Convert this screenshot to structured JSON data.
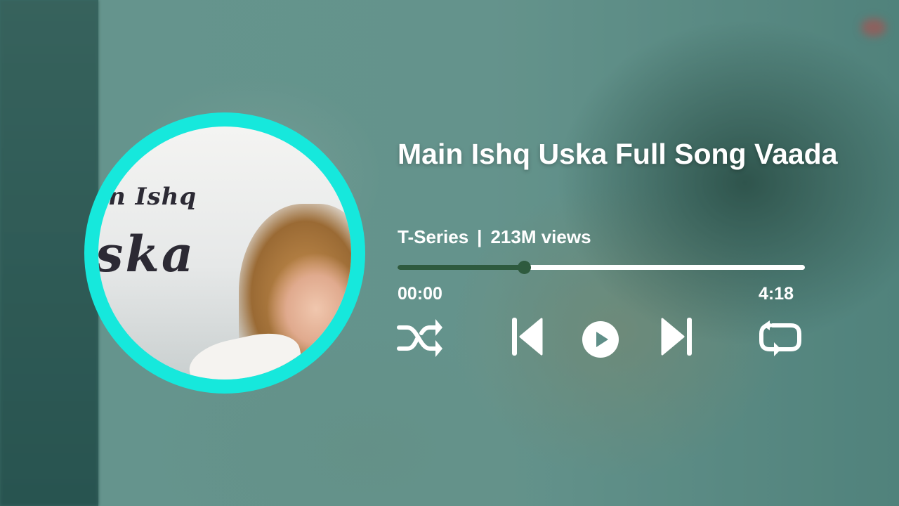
{
  "track": {
    "title": "Main Ishq Uska Full Song Vaada",
    "channel": "T-Series",
    "separator": "|",
    "views": "213M views"
  },
  "album_art": {
    "text_line1": "n Ishq",
    "text_line2": "ska",
    "ring_color": "#16e8dc"
  },
  "progress": {
    "current_time": "00:00",
    "duration": "4:18",
    "fraction": 0.31,
    "played_color": "#2e5a3e",
    "track_color": "#ffffff"
  },
  "controls": {
    "shuffle": "shuffle-icon",
    "previous": "skip-previous-icon",
    "play": "play-circle-icon",
    "next": "skip-next-icon",
    "repeat": "repeat-icon"
  }
}
